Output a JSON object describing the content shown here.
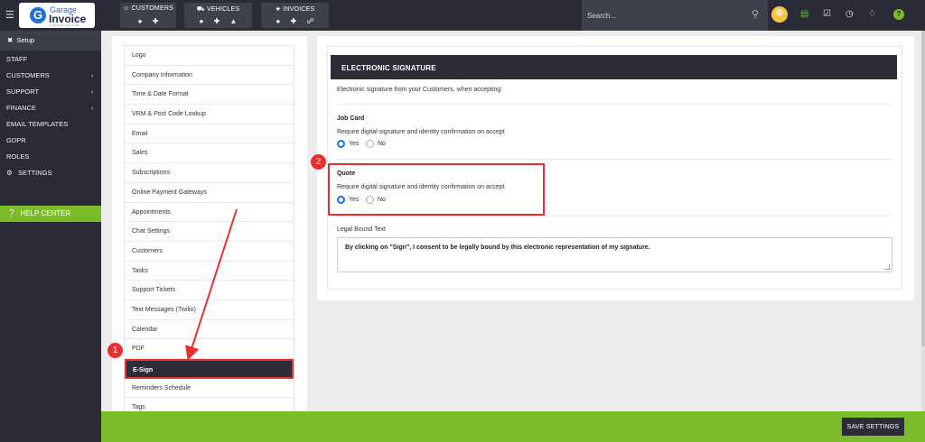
{
  "header": {
    "logo_top": "Garage",
    "logo_main": "Invoice",
    "logo_sub": "GARAGE INVOICE",
    "nav": [
      {
        "label": "CUSTOMERS",
        "icon": "user-icon",
        "actions": [
          "view-icon",
          "add-icon"
        ]
      },
      {
        "label": "VEHICLES",
        "icon": "car-icon",
        "actions": [
          "view-icon",
          "add-icon",
          "bell-icon"
        ]
      },
      {
        "label": "INVOICES",
        "icon": "star-icon",
        "actions": [
          "view-icon",
          "add-icon",
          "link-icon"
        ]
      }
    ],
    "search_placeholder": "Search...",
    "help_badge": "?"
  },
  "sidebar": {
    "setup_label": "Setup",
    "items": [
      {
        "label": "STAFF",
        "chevron": false
      },
      {
        "label": "CUSTOMERS",
        "chevron": true
      },
      {
        "label": "SUPPORT",
        "chevron": true
      },
      {
        "label": "FINANCE",
        "chevron": true
      },
      {
        "label": "EMAIL TEMPLATES",
        "chevron": false
      },
      {
        "label": "GDPR",
        "chevron": false
      },
      {
        "label": "ROLES",
        "chevron": false
      },
      {
        "label": "SETTINGS",
        "chevron": false
      }
    ],
    "help_center": "HELP CENTER"
  },
  "settings_menu": [
    "Logo",
    "Company Information",
    "Time & Date Format",
    "VRM & Post Code Lookup",
    "Email",
    "Sales",
    "Subscriptions",
    "Online Payment Gateways",
    "Appointments",
    "Chat Settings",
    "Customers",
    "Tasks",
    "Support Tickets",
    "Text Messages (Twilio)",
    "Calendar",
    "PDF",
    "E-Sign",
    "Reminders Schedule",
    "Tags"
  ],
  "settings_menu_active": "E-Sign",
  "panel": {
    "title": "ELECTRONIC SIGNATURE",
    "intro": "Electronic signature from your Customers, when accepting:",
    "job_card": {
      "title": "Job Card",
      "desc": "Require digital signature and identity confirmation on accept",
      "yes": "Yes",
      "no": "No",
      "selected": "Yes"
    },
    "quote": {
      "title": "Quote",
      "desc": "Require digital signature and identity confirmation on accept",
      "yes": "Yes",
      "no": "No",
      "selected": "Yes"
    },
    "legal_label": "Legal Bound Text",
    "legal_text": "By clicking on \"Sign\", I consent to be legally bound by this electronic representation of my signature."
  },
  "annotations": {
    "step1": "1",
    "step2": "2",
    "color": "#e8312e"
  },
  "footer": {
    "save_label": "SAVE SETTINGS"
  },
  "colors": {
    "dark": "#2a2b36",
    "accent_green": "#7cbb2a",
    "radio_blue": "#1a73e8"
  }
}
